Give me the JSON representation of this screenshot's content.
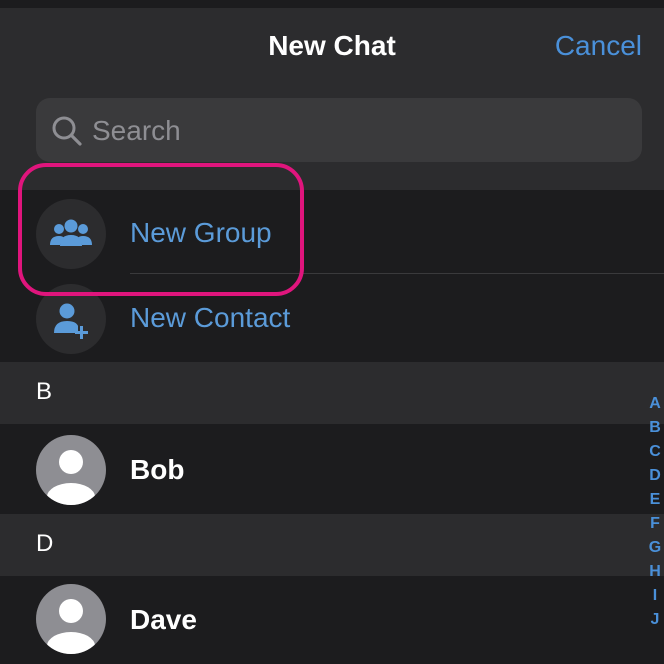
{
  "header": {
    "title": "New Chat",
    "cancel_label": "Cancel"
  },
  "search": {
    "placeholder": "Search",
    "value": ""
  },
  "actions": [
    {
      "label": "New Group",
      "icon": "group-icon"
    },
    {
      "label": "New Contact",
      "icon": "add-contact-icon"
    }
  ],
  "sections": [
    {
      "letter": "B",
      "contacts": [
        {
          "name": "Bob",
          "icon": "person-avatar-icon"
        }
      ]
    },
    {
      "letter": "D",
      "contacts": [
        {
          "name": "Dave",
          "icon": "person-avatar-icon"
        }
      ]
    }
  ],
  "index_letters": [
    "A",
    "B",
    "C",
    "D",
    "E",
    "F",
    "G",
    "H",
    "I",
    "J"
  ],
  "colors": {
    "accent": "#4a90d9",
    "highlight": "#e0157d",
    "background": "#1c1c1e",
    "header": "#2c2c2e"
  }
}
